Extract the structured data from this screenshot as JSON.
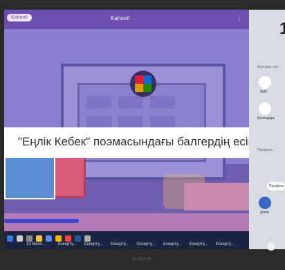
{
  "window": {
    "tab_label": "Kahoot!",
    "title": "Kahoot!",
    "more_icon": "⋮"
  },
  "game": {
    "question": "\"Еңлік Кебек\" поэмасындағы балгердің есімі кім?",
    "logo_colors": [
      "#e21b3c",
      "#1368ce",
      "#d89e00",
      "#26890c"
    ],
    "progress_fraction": 0.3
  },
  "taskbar": {
    "icons": [
      "windows-icon",
      "search-icon",
      "task-view-icon",
      "browser-icon",
      "mail-icon",
      "files-icon",
      "chrome-icon",
      "word-icon",
      "settings-icon"
    ],
    "tabs": [
      "12 Mess...",
      "Ескерту...",
      "Ескерту...",
      "Ескерту...",
      "Ескерту...",
      "Ескерту...",
      "Ескерту...",
      "Ескерту..."
    ]
  },
  "side_panel": {
    "time": "1",
    "quick_settings_label": "Быстрые нас",
    "wifi_label": "WiFi",
    "calendar_label": "Календарь",
    "profiles_label": "Профили",
    "profile_chip": "Профиль",
    "home_label": "Дома"
  },
  "bezel": {
    "brand": "ROOED"
  },
  "colors": {
    "accent": "#6e4fb0",
    "banner": "#ffffff",
    "progress": "#3b46c8"
  }
}
